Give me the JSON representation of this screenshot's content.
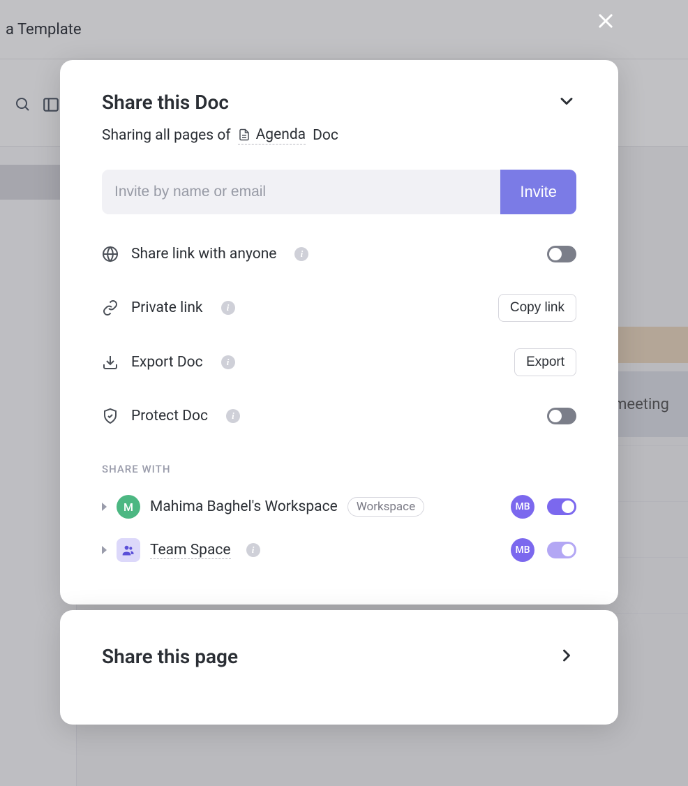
{
  "background": {
    "title_suffix": "a Template",
    "peek_text": "e meeting"
  },
  "close_label": "Close",
  "modal": {
    "title": "Share this Doc",
    "subheader_prefix": "Sharing all pages of",
    "doc_name": "Agenda",
    "doc_suffix": "Doc",
    "invite_placeholder": "Invite by name or email",
    "invite_button": "Invite",
    "options": {
      "share_link": "Share link with anyone",
      "private_link": "Private link",
      "copy_link": "Copy link",
      "export_doc": "Export Doc",
      "export": "Export",
      "protect_doc": "Protect Doc"
    },
    "share_with_label": "SHARE WITH",
    "rows": [
      {
        "avatar_letter": "M",
        "name": "Mahima Baghel's Workspace",
        "badge": "Workspace",
        "member_initials": "MB",
        "toggle_on": true
      },
      {
        "name": "Team Space",
        "member_initials": "MB",
        "toggle_on": true
      }
    ]
  },
  "secondary_modal": {
    "title": "Share this page"
  }
}
